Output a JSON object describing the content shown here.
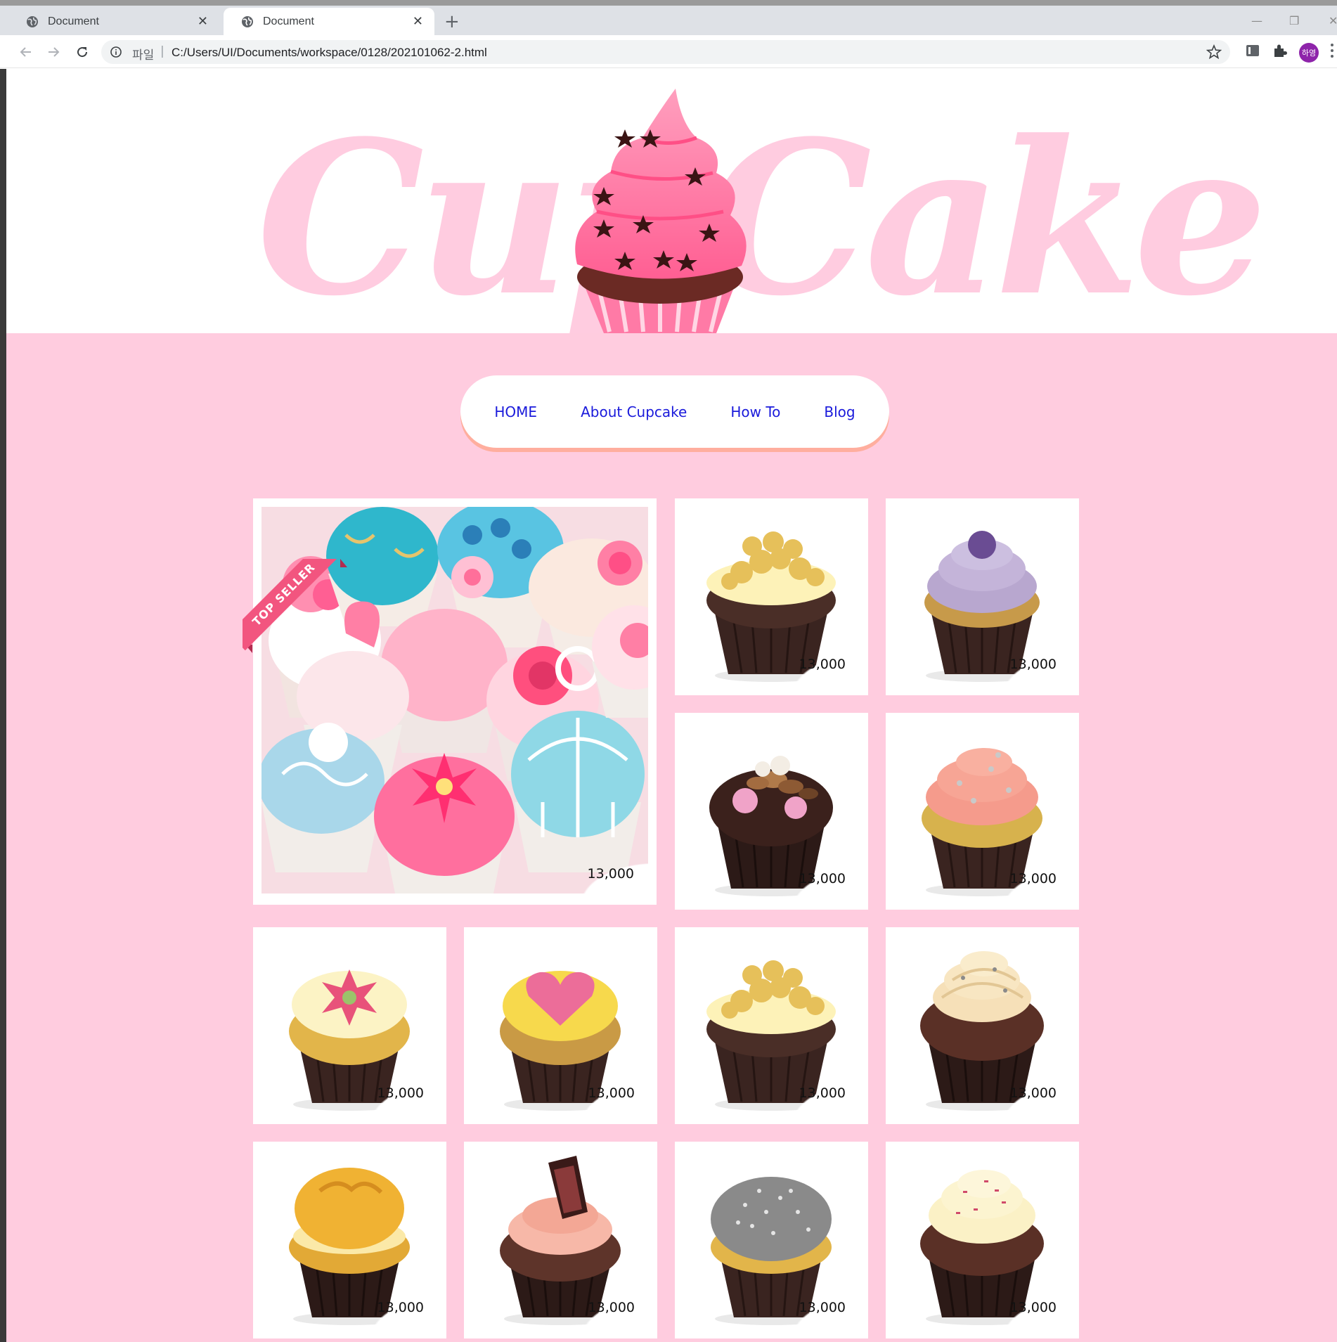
{
  "browser": {
    "tabs": [
      {
        "title": "Document",
        "active": false
      },
      {
        "title": "Document",
        "active": true
      }
    ],
    "new_tab_symbol": "+",
    "close_symbol": "✕",
    "address": {
      "scheme_label": "파일",
      "separator": "|",
      "url": "C:/Users/UI/Documents/workspace/0128/202101062-2.html"
    },
    "profile_initials": "하영",
    "window_controls": {
      "minimize": "—",
      "restore": "❐",
      "close": "✕"
    }
  },
  "site": {
    "logo_text": "CupCake",
    "nav": [
      {
        "label": "HOME"
      },
      {
        "label": "About Cupcake"
      },
      {
        "label": "How To"
      },
      {
        "label": "Blog"
      }
    ],
    "ribbon_text": "TOP SELLER",
    "products": [
      {
        "name": "featured-assorted",
        "price": "13,000",
        "featured": true
      },
      {
        "name": "crumble-top",
        "price": "13,000"
      },
      {
        "name": "lavender-swirl",
        "price": "13,000"
      },
      {
        "name": "nutty-marshmallow",
        "price": "13,000"
      },
      {
        "name": "peach-swirl",
        "price": "13,000"
      },
      {
        "name": "flower-fondant",
        "price": "13,000"
      },
      {
        "name": "heart-fondant",
        "price": "13,000"
      },
      {
        "name": "crumble-top-2",
        "price": "13,000"
      },
      {
        "name": "vanilla-chocolate-swirl",
        "price": "13,000"
      },
      {
        "name": "cream-puff",
        "price": "13,000"
      },
      {
        "name": "chocolate-wafer",
        "price": "13,000"
      },
      {
        "name": "coconut-dome",
        "price": "13,000"
      },
      {
        "name": "sprinkle-swirl",
        "price": "13,000"
      }
    ]
  },
  "colors": {
    "brand_pink": "#ffccdf",
    "logo_pink": "#ffcce0",
    "nav_link": "#1a1adb",
    "nav_shadow": "#ffae9e",
    "ribbon": "#f2557f"
  },
  "icons": [
    "globe-icon",
    "back-arrow-icon",
    "forward-arrow-icon",
    "reload-icon",
    "info-icon",
    "star-icon",
    "reader-icon",
    "puzzle-icon",
    "menu-icon"
  ]
}
